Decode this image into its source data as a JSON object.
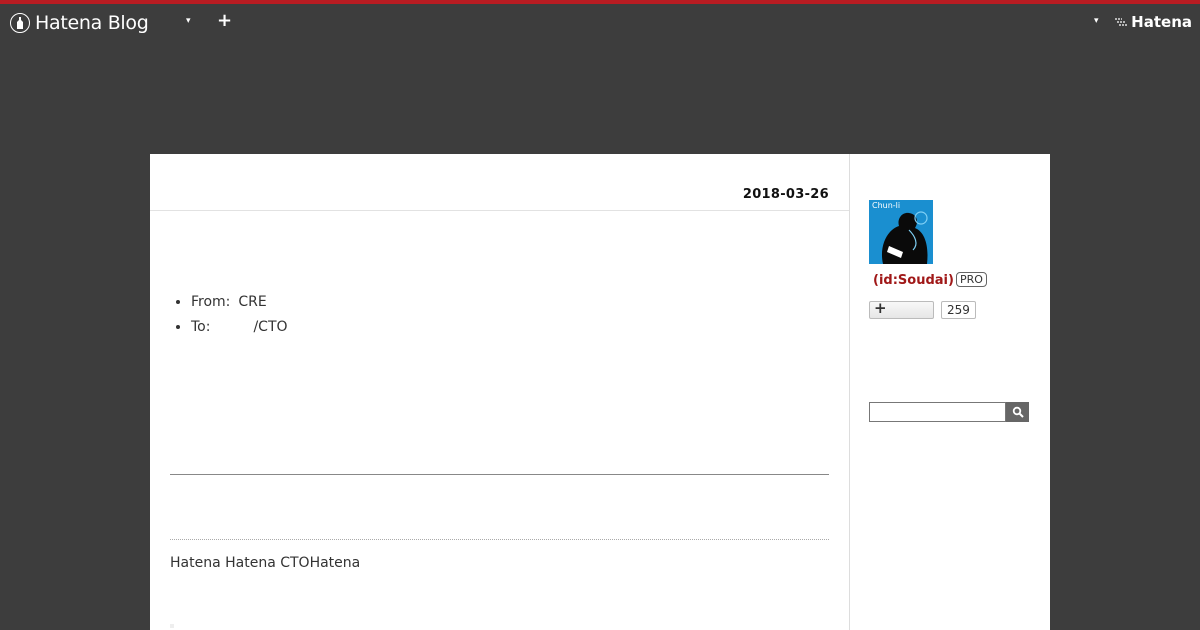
{
  "global_header": {
    "logo_text": "Hatena Blog",
    "brand_text": "Hatena"
  },
  "entry": {
    "date": "2018-03-26",
    "list": [
      {
        "key": "From:",
        "value": "CRE"
      },
      {
        "key": "To:",
        "value": "/CTO"
      }
    ],
    "footer_text": "Hatena Hatena  CTOHatena"
  },
  "sidebar": {
    "avatar_label": "Chun-li",
    "user_id": "(id:Soudai)",
    "pro_badge": "PRO",
    "follow_count": "259",
    "search_placeholder": ""
  },
  "colors": {
    "header_bg": "#3d3d3d",
    "top_accent": "#b81c22",
    "user_id": "#a01818"
  }
}
